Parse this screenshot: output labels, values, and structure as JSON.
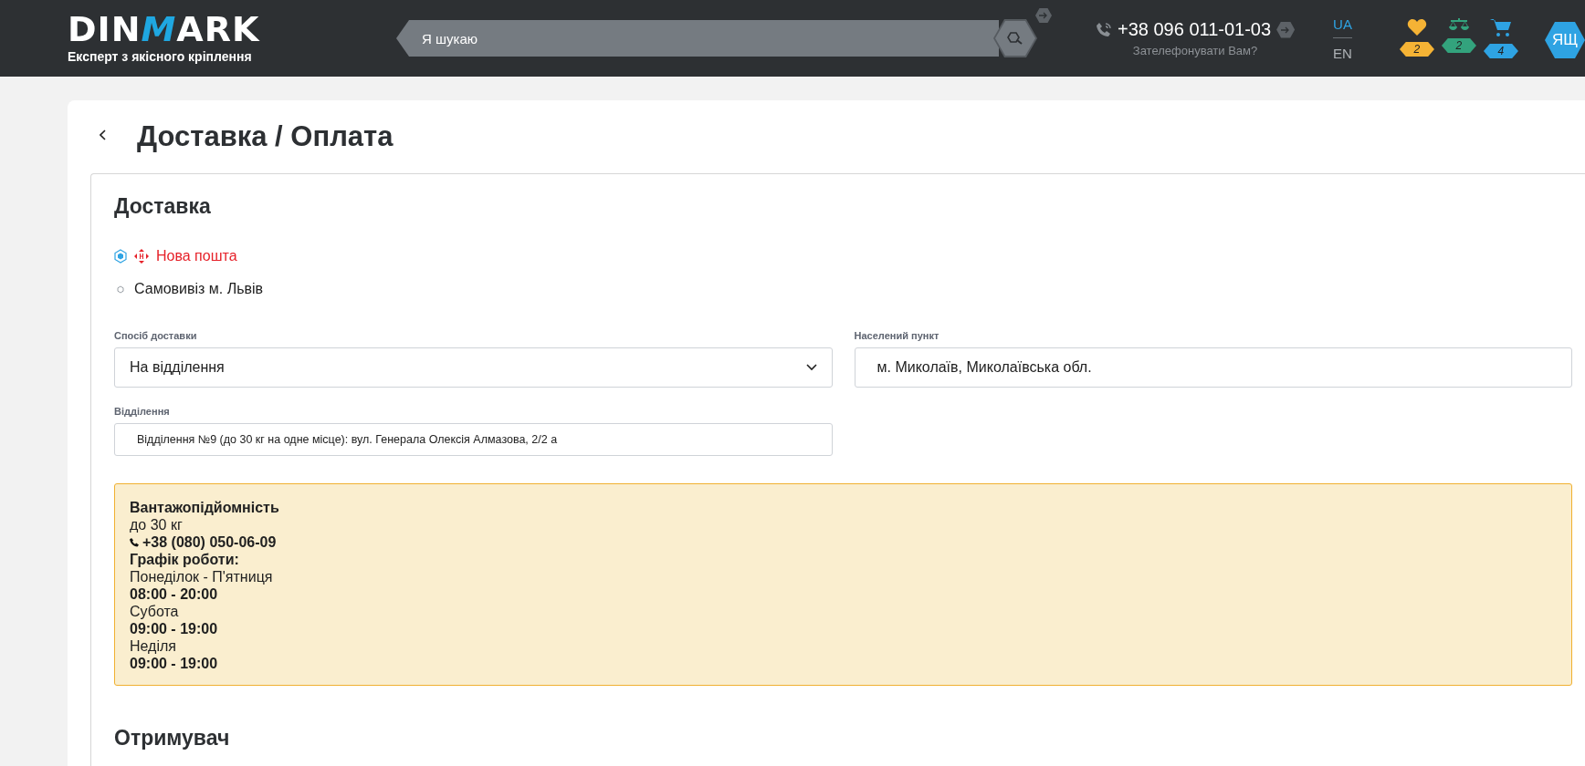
{
  "header": {
    "logo": {
      "text_before": "DIN",
      "accent": "M",
      "text_after": "ARK",
      "tagline": "Експерт з якісного кріплення"
    },
    "search": {
      "placeholder": "Я шукаю"
    },
    "phone": {
      "number": "+38 096 011-01-03",
      "callback": "Зателефонувати Вам?"
    },
    "languages": [
      {
        "label": "UA",
        "selected": true
      },
      {
        "label": "EN",
        "selected": false
      }
    ],
    "counters": [
      {
        "kind": "heart",
        "count": "2",
        "color": "#f5b335"
      },
      {
        "kind": "scales",
        "count": "2",
        "color": "#33a37d"
      },
      {
        "kind": "cart",
        "count": "4",
        "color": "#2ea3e3"
      }
    ],
    "user": {
      "initials": "ЯЩ"
    }
  },
  "page": {
    "title": "Доставка / Оплата"
  },
  "delivery": {
    "heading": "Доставка",
    "options": [
      {
        "kind": "brand",
        "label": "Нова пошта",
        "selected": true
      },
      {
        "kind": "plain",
        "label": "Самовивіз м. Львів",
        "selected": false
      }
    ],
    "fields": [
      {
        "kind": "select",
        "label": "Спосіб доставки",
        "value": "На відділення"
      },
      {
        "kind": "text",
        "label": "Населений пункт",
        "value": "м. Миколаїв, Миколаївська обл."
      },
      {
        "kind": "small",
        "label": "Відділення",
        "value": "Відділення №9 (до 30 кг на одне місце): вул. Генерала Олексія Алмазова, 2/2 а"
      }
    ],
    "info": [
      {
        "kind": "text",
        "text": "Вантажопідйомність",
        "bold": true
      },
      {
        "kind": "text",
        "text": "до 30 кг",
        "bold": false
      },
      {
        "kind": "phone",
        "text": "+38 (080) 050-06-09",
        "bold": true
      },
      {
        "kind": "text",
        "text": "Графік роботи:",
        "bold": true
      },
      {
        "kind": "text",
        "text": "Понеділок - П'ятниця",
        "bold": false
      },
      {
        "kind": "text",
        "text": "08:00 - 20:00",
        "bold": true
      },
      {
        "kind": "text",
        "text": "Субота",
        "bold": false
      },
      {
        "kind": "text",
        "text": "09:00 - 19:00",
        "bold": true
      },
      {
        "kind": "text",
        "text": "Неділя",
        "bold": false
      },
      {
        "kind": "text",
        "text": "09:00 - 19:00",
        "bold": true
      }
    ]
  },
  "recipient": {
    "heading": "Отримувач"
  }
}
